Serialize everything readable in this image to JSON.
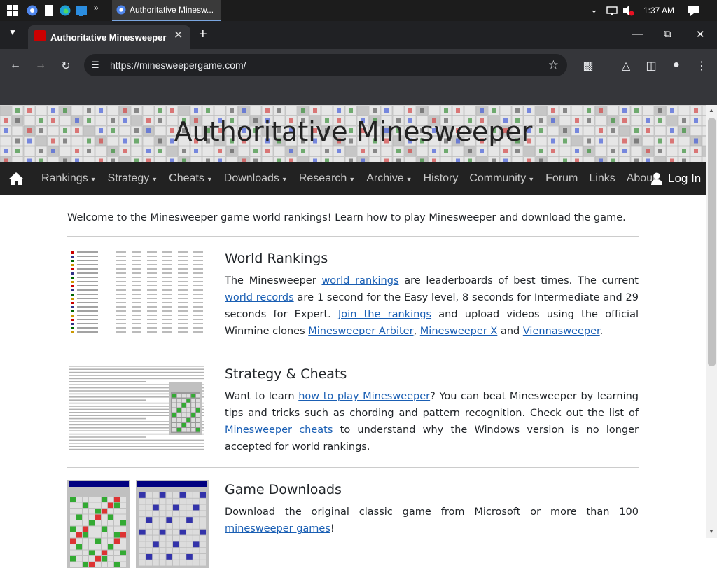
{
  "taskbar": {
    "task_title": "Authoritative Minesw...",
    "time": "1:37 AM",
    "icons": [
      "windows-start-icon",
      "chrome-icon",
      "file-icon",
      "edge-icon",
      "terminal-icon"
    ]
  },
  "browser": {
    "tab_title": "Authoritative Minesweeper",
    "url": "https://minesweepergame.com/"
  },
  "site": {
    "title": "Authoritative Minesweeper",
    "nav": [
      {
        "label": "Rankings",
        "dropdown": true
      },
      {
        "label": "Strategy",
        "dropdown": true
      },
      {
        "label": "Cheats",
        "dropdown": true
      },
      {
        "label": "Downloads",
        "dropdown": true
      },
      {
        "label": "Research",
        "dropdown": true
      },
      {
        "label": "Archive",
        "dropdown": true
      },
      {
        "label": "History",
        "dropdown": false
      },
      {
        "label": "Community",
        "dropdown": true
      },
      {
        "label": "Forum",
        "dropdown": false
      },
      {
        "label": "Links",
        "dropdown": false
      },
      {
        "label": "About",
        "dropdown": false
      }
    ],
    "login": "Log In"
  },
  "content": {
    "welcome": "Welcome to the Minesweeper game world rankings! Learn how to play Minesweeper and download the game.",
    "features": [
      {
        "title": "World Rankings",
        "parts": [
          {
            "t": "The Minesweeper "
          },
          {
            "t": "world rankings",
            "link": true
          },
          {
            "t": " are leaderboards of best times. The current "
          },
          {
            "t": "world records",
            "link": true
          },
          {
            "t": " are 1 second for the Easy level, 8 seconds for Intermediate and 29 seconds for Expert. "
          },
          {
            "t": "Join the rankings",
            "link": true
          },
          {
            "t": " and upload videos using the official Winmine clones "
          },
          {
            "t": "Minesweeper Arbiter",
            "link": true
          },
          {
            "t": ", "
          },
          {
            "t": "Minesweeper X",
            "link": true
          },
          {
            "t": " and "
          },
          {
            "t": "Viennasweeper",
            "link": true
          },
          {
            "t": "."
          }
        ]
      },
      {
        "title": "Strategy & Cheats",
        "parts": [
          {
            "t": "Want to learn "
          },
          {
            "t": "how to play Minesweeper",
            "link": true
          },
          {
            "t": "? You can beat Minesweeper by learning tips and tricks such as chording and pattern recognition. Check out the list of "
          },
          {
            "t": "Minesweeper cheats",
            "link": true
          },
          {
            "t": " to understand why the Windows version is no longer accepted for world rankings."
          }
        ]
      },
      {
        "title": "Game Downloads",
        "parts": [
          {
            "t": "Download the original classic game from Microsoft or more than 100 "
          },
          {
            "t": "minesweeper games",
            "link": true
          },
          {
            "t": "!"
          }
        ]
      }
    ]
  }
}
